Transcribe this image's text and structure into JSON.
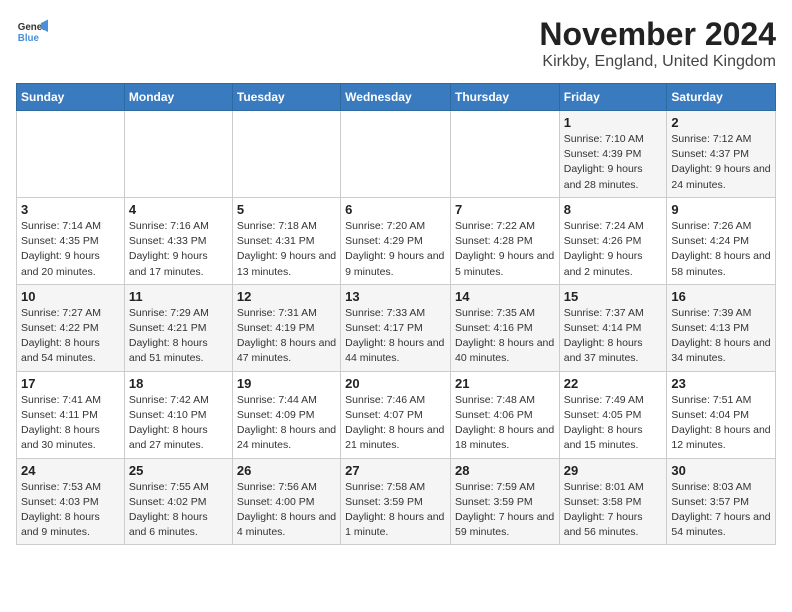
{
  "header": {
    "logo_line1": "General",
    "logo_line2": "Blue",
    "month_title": "November 2024",
    "location": "Kirkby, England, United Kingdom"
  },
  "weekdays": [
    "Sunday",
    "Monday",
    "Tuesday",
    "Wednesday",
    "Thursday",
    "Friday",
    "Saturday"
  ],
  "weeks": [
    [
      {
        "day": "",
        "info": ""
      },
      {
        "day": "",
        "info": ""
      },
      {
        "day": "",
        "info": ""
      },
      {
        "day": "",
        "info": ""
      },
      {
        "day": "",
        "info": ""
      },
      {
        "day": "1",
        "info": "Sunrise: 7:10 AM\nSunset: 4:39 PM\nDaylight: 9 hours and 28 minutes."
      },
      {
        "day": "2",
        "info": "Sunrise: 7:12 AM\nSunset: 4:37 PM\nDaylight: 9 hours and 24 minutes."
      }
    ],
    [
      {
        "day": "3",
        "info": "Sunrise: 7:14 AM\nSunset: 4:35 PM\nDaylight: 9 hours and 20 minutes."
      },
      {
        "day": "4",
        "info": "Sunrise: 7:16 AM\nSunset: 4:33 PM\nDaylight: 9 hours and 17 minutes."
      },
      {
        "day": "5",
        "info": "Sunrise: 7:18 AM\nSunset: 4:31 PM\nDaylight: 9 hours and 13 minutes."
      },
      {
        "day": "6",
        "info": "Sunrise: 7:20 AM\nSunset: 4:29 PM\nDaylight: 9 hours and 9 minutes."
      },
      {
        "day": "7",
        "info": "Sunrise: 7:22 AM\nSunset: 4:28 PM\nDaylight: 9 hours and 5 minutes."
      },
      {
        "day": "8",
        "info": "Sunrise: 7:24 AM\nSunset: 4:26 PM\nDaylight: 9 hours and 2 minutes."
      },
      {
        "day": "9",
        "info": "Sunrise: 7:26 AM\nSunset: 4:24 PM\nDaylight: 8 hours and 58 minutes."
      }
    ],
    [
      {
        "day": "10",
        "info": "Sunrise: 7:27 AM\nSunset: 4:22 PM\nDaylight: 8 hours and 54 minutes."
      },
      {
        "day": "11",
        "info": "Sunrise: 7:29 AM\nSunset: 4:21 PM\nDaylight: 8 hours and 51 minutes."
      },
      {
        "day": "12",
        "info": "Sunrise: 7:31 AM\nSunset: 4:19 PM\nDaylight: 8 hours and 47 minutes."
      },
      {
        "day": "13",
        "info": "Sunrise: 7:33 AM\nSunset: 4:17 PM\nDaylight: 8 hours and 44 minutes."
      },
      {
        "day": "14",
        "info": "Sunrise: 7:35 AM\nSunset: 4:16 PM\nDaylight: 8 hours and 40 minutes."
      },
      {
        "day": "15",
        "info": "Sunrise: 7:37 AM\nSunset: 4:14 PM\nDaylight: 8 hours and 37 minutes."
      },
      {
        "day": "16",
        "info": "Sunrise: 7:39 AM\nSunset: 4:13 PM\nDaylight: 8 hours and 34 minutes."
      }
    ],
    [
      {
        "day": "17",
        "info": "Sunrise: 7:41 AM\nSunset: 4:11 PM\nDaylight: 8 hours and 30 minutes."
      },
      {
        "day": "18",
        "info": "Sunrise: 7:42 AM\nSunset: 4:10 PM\nDaylight: 8 hours and 27 minutes."
      },
      {
        "day": "19",
        "info": "Sunrise: 7:44 AM\nSunset: 4:09 PM\nDaylight: 8 hours and 24 minutes."
      },
      {
        "day": "20",
        "info": "Sunrise: 7:46 AM\nSunset: 4:07 PM\nDaylight: 8 hours and 21 minutes."
      },
      {
        "day": "21",
        "info": "Sunrise: 7:48 AM\nSunset: 4:06 PM\nDaylight: 8 hours and 18 minutes."
      },
      {
        "day": "22",
        "info": "Sunrise: 7:49 AM\nSunset: 4:05 PM\nDaylight: 8 hours and 15 minutes."
      },
      {
        "day": "23",
        "info": "Sunrise: 7:51 AM\nSunset: 4:04 PM\nDaylight: 8 hours and 12 minutes."
      }
    ],
    [
      {
        "day": "24",
        "info": "Sunrise: 7:53 AM\nSunset: 4:03 PM\nDaylight: 8 hours and 9 minutes."
      },
      {
        "day": "25",
        "info": "Sunrise: 7:55 AM\nSunset: 4:02 PM\nDaylight: 8 hours and 6 minutes."
      },
      {
        "day": "26",
        "info": "Sunrise: 7:56 AM\nSunset: 4:00 PM\nDaylight: 8 hours and 4 minutes."
      },
      {
        "day": "27",
        "info": "Sunrise: 7:58 AM\nSunset: 3:59 PM\nDaylight: 8 hours and 1 minute."
      },
      {
        "day": "28",
        "info": "Sunrise: 7:59 AM\nSunset: 3:59 PM\nDaylight: 7 hours and 59 minutes."
      },
      {
        "day": "29",
        "info": "Sunrise: 8:01 AM\nSunset: 3:58 PM\nDaylight: 7 hours and 56 minutes."
      },
      {
        "day": "30",
        "info": "Sunrise: 8:03 AM\nSunset: 3:57 PM\nDaylight: 7 hours and 54 minutes."
      }
    ]
  ]
}
